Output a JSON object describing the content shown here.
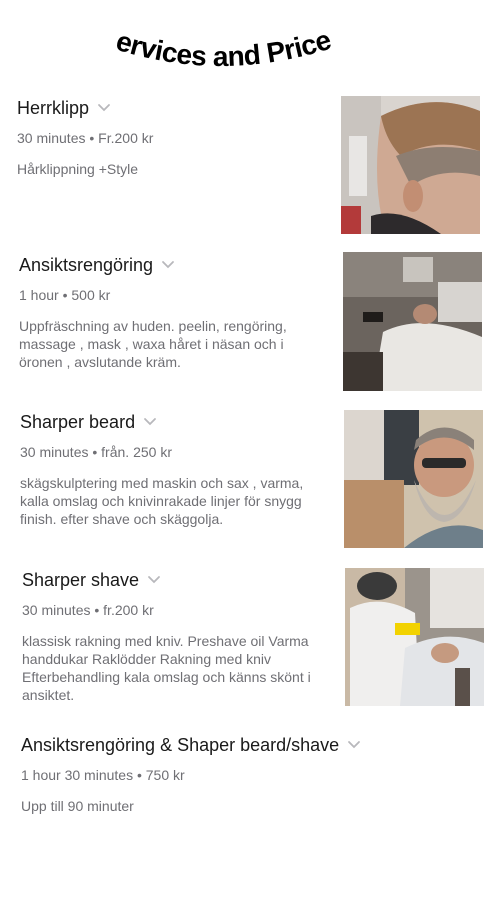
{
  "page": {
    "title": "Services and Prices"
  },
  "services": [
    {
      "name": "Herrklipp",
      "meta": "30 minutes • Fr.200 kr",
      "description": "Hårklippning +Style",
      "photo": "haircut-fade-photo"
    },
    {
      "name": "Ansiktsrengöring",
      "meta": "1 hour • 500 kr",
      "description": "Uppfräschning av huden. peelin, rengöring, massage , mask , waxa håret i näsan och i öronen , avslutande kräm.",
      "photo": "facial-treatment-photo"
    },
    {
      "name": "Sharper beard",
      "meta": "30 minutes • från. 250 kr",
      "description": "skägskulptering med maskin och sax , varma, kalla omslag och knivinrakade linjer för snygg finish. efter shave och skäggolja.",
      "photo": "bearded-man-photo"
    },
    {
      "name": "Sharper shave",
      "meta": "30 minutes • fr.200 kr",
      "description": "klassisk rakning med kniv. Preshave oil Varma handdukar Raklödder Rakning med kniv Efterbehandling kala omslag och känns skönt i ansiktet.",
      "photo": "straight-razor-shave-photo"
    },
    {
      "name": "Ansiktsrengöring & Shaper beard/shave",
      "meta": "1 hour 30 minutes • 750 kr",
      "description": "Upp till 90 minuter",
      "photo": null
    }
  ],
  "icons": {
    "expand": "chevron-down-icon"
  },
  "colors": {
    "text_primary": "#1a1a1a",
    "text_secondary": "#6f6f74",
    "chevron": "#b8b8bc"
  }
}
